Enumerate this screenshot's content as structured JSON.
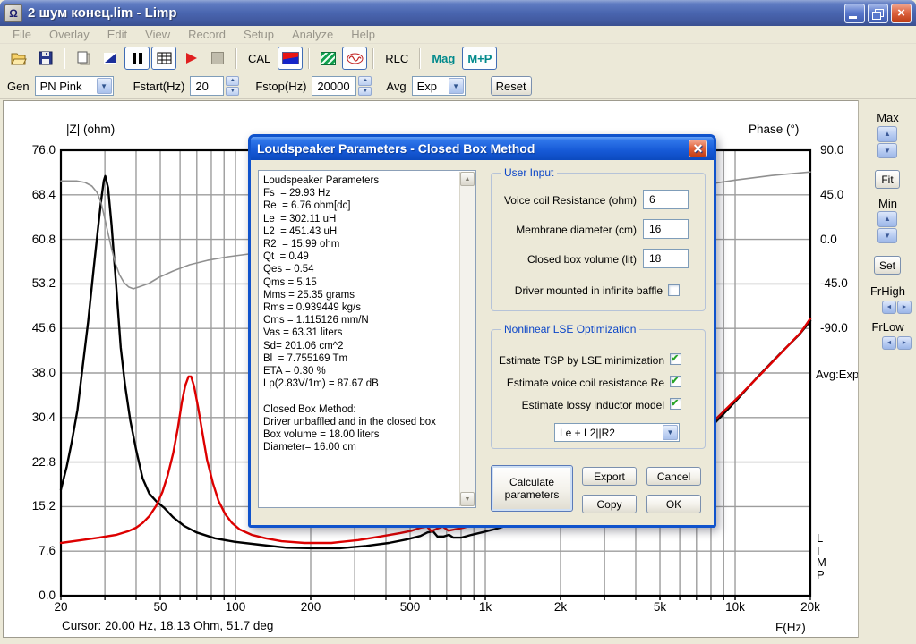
{
  "window": {
    "title": "2 шум конец.lim - Limp"
  },
  "menu": {
    "items": [
      "File",
      "Overlay",
      "Edit",
      "View",
      "Record",
      "Setup",
      "Analyze",
      "Help"
    ]
  },
  "toolbar": {
    "cal": "CAL",
    "rlc": "RLC",
    "mag": "Mag",
    "mp": "M+P"
  },
  "gen_bar": {
    "gen_label": "Gen",
    "gen_value": "PN Pink",
    "fstart_label": "Fstart(Hz)",
    "fstart_value": "20",
    "fstop_label": "Fstop(Hz)",
    "fstop_value": "20000",
    "avg_label": "Avg",
    "avg_value": "Exp",
    "reset": "Reset"
  },
  "right_panel": {
    "max": "Max",
    "fit": "Fit",
    "min": "Min",
    "set": "Set",
    "fr_high": "FrHigh",
    "fr_low": "FrLow"
  },
  "chart": {
    "zl_title": "|Z| (ohm)",
    "phase_title": "Phase (°)",
    "f_title": "F(Hz)",
    "avg_indicator": "Avg:Exp",
    "watermark": "L\nI\nM\nP",
    "cursor_status": "Cursor: 20.00 Hz, 18.13 Ohm, 51.7 deg"
  },
  "chart_data": {
    "type": "line",
    "x_axis": {
      "label": "F(Hz)",
      "scale": "log",
      "min": 20,
      "max": 20000,
      "ticks": [
        {
          "f": 20,
          "label": "20"
        },
        {
          "f": 50,
          "label": "50"
        },
        {
          "f": 100,
          "label": "100"
        },
        {
          "f": 200,
          "label": "200"
        },
        {
          "f": 500,
          "label": "500"
        },
        {
          "f": 1000,
          "label": "1k"
        },
        {
          "f": 2000,
          "label": "2k"
        },
        {
          "f": 5000,
          "label": "5k"
        },
        {
          "f": 10000,
          "label": "10k"
        },
        {
          "f": 20000,
          "label": "20k"
        }
      ],
      "grid_freqs": [
        30,
        40,
        50,
        60,
        70,
        80,
        90,
        100,
        200,
        300,
        400,
        500,
        600,
        700,
        800,
        900,
        1000,
        2000,
        3000,
        4000,
        5000,
        6000,
        7000,
        8000,
        9000,
        10000
      ]
    },
    "y_left": {
      "label": "|Z| (ohm)",
      "min": 0,
      "max": 76,
      "tick_values": [
        76,
        68.4,
        60.8,
        53.2,
        45.6,
        38,
        30.4,
        22.8,
        15.2,
        7.6,
        0
      ]
    },
    "y_right": {
      "label": "Phase (°)",
      "min": -90,
      "max": 90,
      "tick_values": [
        90,
        45,
        0,
        -45,
        -90
      ]
    },
    "series": [
      {
        "name": "impedance-free-air",
        "color": "#000000",
        "axis": "left",
        "points": [
          [
            20,
            18.1
          ],
          [
            21.1,
            22
          ],
          [
            22.1,
            26.2
          ],
          [
            23.3,
            31.7
          ],
          [
            24.4,
            38.8
          ],
          [
            25.7,
            46.7
          ],
          [
            27,
            55.5
          ],
          [
            28.1,
            62.3
          ],
          [
            29,
            67.5
          ],
          [
            29.7,
            70.8
          ],
          [
            30.1,
            71.6
          ],
          [
            30.9,
            69.6
          ],
          [
            31.9,
            63.2
          ],
          [
            33.3,
            52.8
          ],
          [
            34.7,
            42.4
          ],
          [
            36.1,
            36
          ],
          [
            37.9,
            29.9
          ],
          [
            40,
            24.9
          ],
          [
            42.5,
            20
          ],
          [
            45.2,
            17.4
          ],
          [
            48.5,
            16
          ],
          [
            51.8,
            15
          ],
          [
            56.2,
            13.4
          ],
          [
            62.3,
            11.9
          ],
          [
            69.8,
            10.8
          ],
          [
            82.6,
            9.8
          ],
          [
            99,
            9.2
          ],
          [
            125,
            8.7
          ],
          [
            160,
            8.2
          ],
          [
            204,
            8.1
          ],
          [
            262,
            8.1
          ],
          [
            334,
            8.5
          ],
          [
            411,
            9
          ],
          [
            485,
            9.6
          ],
          [
            550,
            10.2
          ],
          [
            587,
            10.8
          ],
          [
            617,
            11
          ],
          [
            643,
            10.1
          ],
          [
            682,
            10.1
          ],
          [
            716,
            10.4
          ],
          [
            745,
            9.9
          ],
          [
            800,
            9.9
          ],
          [
            882,
            10.4
          ],
          [
            970,
            10.8
          ],
          [
            1100,
            11.4
          ],
          [
            1270,
            12.2
          ],
          [
            1470,
            13
          ],
          [
            1780,
            13.9
          ],
          [
            2150,
            15
          ],
          [
            2660,
            16.2
          ],
          [
            3280,
            17.5
          ],
          [
            4040,
            19.1
          ],
          [
            5000,
            20.9
          ],
          [
            6170,
            23
          ],
          [
            7280,
            25.6
          ],
          [
            8350,
            29.6
          ],
          [
            10100,
            33.3
          ],
          [
            12400,
            37.5
          ],
          [
            15300,
            41.5
          ],
          [
            18100,
            44.6
          ],
          [
            20000,
            46.9
          ]
        ]
      },
      {
        "name": "impedance-closed-box",
        "color": "#dd0000",
        "axis": "left",
        "points": [
          [
            20,
            9
          ],
          [
            24.2,
            9.5
          ],
          [
            28.4,
            9.9
          ],
          [
            33.4,
            10.4
          ],
          [
            37.2,
            11
          ],
          [
            40,
            11.6
          ],
          [
            42.5,
            12.4
          ],
          [
            45.2,
            13.6
          ],
          [
            48.1,
            15.3
          ],
          [
            51,
            17.7
          ],
          [
            53.6,
            20.6
          ],
          [
            56.3,
            24.3
          ],
          [
            58.7,
            28.5
          ],
          [
            61,
            33
          ],
          [
            63,
            35.9
          ],
          [
            64.9,
            37.4
          ],
          [
            66.4,
            37.4
          ],
          [
            68.3,
            35.7
          ],
          [
            70.9,
            32.1
          ],
          [
            73.9,
            27.5
          ],
          [
            76.9,
            23.2
          ],
          [
            81.2,
            19.2
          ],
          [
            85.5,
            16.2
          ],
          [
            91,
            13.9
          ],
          [
            96.8,
            12.4
          ],
          [
            104,
            11.3
          ],
          [
            116,
            10.4
          ],
          [
            132,
            9.8
          ],
          [
            153,
            9.3
          ],
          [
            189,
            9
          ],
          [
            242,
            9
          ],
          [
            310,
            9.5
          ],
          [
            380,
            10.1
          ],
          [
            457,
            10.7
          ],
          [
            508,
            11.1
          ],
          [
            550,
            11.6
          ],
          [
            584,
            11.8
          ],
          [
            608,
            11
          ],
          [
            638,
            11.4
          ],
          [
            675,
            11.8
          ],
          [
            712,
            11.1
          ],
          [
            750,
            11.3
          ],
          [
            816,
            11.6
          ],
          [
            900,
            12.1
          ],
          [
            1010,
            12.5
          ],
          [
            1180,
            13.1
          ],
          [
            1380,
            13.7
          ],
          [
            1630,
            14.5
          ],
          [
            2000,
            15.4
          ],
          [
            2420,
            16.6
          ],
          [
            2930,
            17.9
          ],
          [
            3540,
            19.4
          ],
          [
            4280,
            21.1
          ],
          [
            5130,
            22.9
          ],
          [
            6250,
            25.3
          ],
          [
            7330,
            27.8
          ],
          [
            8350,
            30.1
          ],
          [
            10300,
            33.9
          ],
          [
            12800,
            38
          ],
          [
            15500,
            41.7
          ],
          [
            18300,
            44.9
          ],
          [
            20000,
            47.3
          ]
        ]
      },
      {
        "name": "phase",
        "color": "#909090",
        "axis": "right",
        "points": [
          [
            20,
            59
          ],
          [
            23.1,
            59
          ],
          [
            25,
            57.5
          ],
          [
            26.6,
            53.9
          ],
          [
            27.9,
            47.5
          ],
          [
            29,
            36.7
          ],
          [
            29.9,
            22.2
          ],
          [
            30.9,
            6
          ],
          [
            31.9,
            -9.4
          ],
          [
            33,
            -23.8
          ],
          [
            34.3,
            -35.6
          ],
          [
            35.8,
            -43.7
          ],
          [
            37.4,
            -48.2
          ],
          [
            39,
            -50
          ],
          [
            41,
            -48.2
          ],
          [
            44.9,
            -44.6
          ],
          [
            49.5,
            -38.3
          ],
          [
            56.3,
            -32
          ],
          [
            65.5,
            -25.7
          ],
          [
            77.2,
            -21.2
          ],
          [
            93.6,
            -17.5
          ],
          [
            113,
            -14.8
          ],
          [
            135,
            -12.1
          ],
          [
            174,
            -9.4
          ],
          [
            242,
            -4.9
          ],
          [
            367,
            0.5
          ],
          [
            600,
            7.7
          ],
          [
            980,
            15.9
          ],
          [
            1600,
            24.9
          ],
          [
            2660,
            34.8
          ],
          [
            4380,
            44.7
          ],
          [
            7280,
            54.6
          ],
          [
            10100,
            60
          ],
          [
            14000,
            64.5
          ],
          [
            20000,
            68.1
          ]
        ]
      }
    ]
  },
  "dialog": {
    "title": "Loudspeaker Parameters - Closed Box Method",
    "params_text": "Loudspeaker Parameters\nFs  = 29.93 Hz\nRe  = 6.76 ohm[dc]\nLe  = 302.11 uH\nL2  = 451.43 uH\nR2  = 15.99 ohm\nQt  = 0.49\nQes = 0.54\nQms = 5.15\nMms = 25.35 grams\nRms = 0.939449 kg/s\nCms = 1.115126 mm/N\nVas = 63.31 liters\nSd= 201.06 cm^2\nBl  = 7.755169 Tm\nETA = 0.30 %\nLp(2.83V/1m) = 87.67 dB\n\nClosed Box Method:\nDriver unbaffled and in the closed box\nBox volume = 18.00 liters\nDiameter= 16.00 cm",
    "user_input": {
      "legend": "User Input",
      "fields": [
        {
          "label": "Voice coil Resistance (ohm)",
          "value": "6"
        },
        {
          "label": "Membrane diameter (cm)",
          "value": "16"
        },
        {
          "label": "Closed box volume (lit)",
          "value": "18"
        }
      ],
      "baffle_label": "Driver mounted in infinite baffle",
      "baffle_checked": false
    },
    "lse": {
      "legend": "Nonlinear LSE Optimization",
      "options": [
        {
          "label": "Estimate TSP by LSE minimization",
          "checked": true
        },
        {
          "label": "Estimate voice coil resistance Re",
          "checked": true
        },
        {
          "label": "Estimate lossy inductor model",
          "checked": true
        }
      ],
      "model_value": "Le + L2||R2"
    },
    "buttons": {
      "calculate": "Calculate\nparameters",
      "export": "Export",
      "cancel": "Cancel",
      "copy": "Copy",
      "ok": "OK"
    }
  }
}
